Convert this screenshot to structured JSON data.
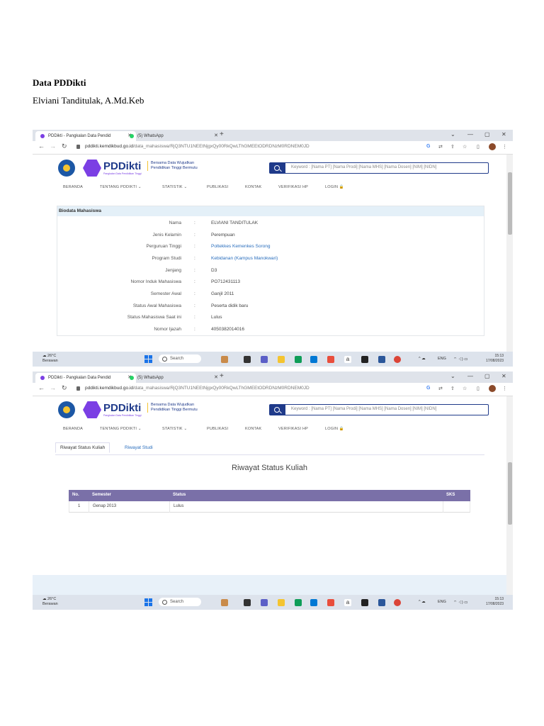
{
  "doc": {
    "title": "Data PDDikti",
    "name": "Elviani Tanditulak, A.Md.Keb"
  },
  "browser": {
    "tab_active": "PDDikti - Pangkalan Data Pendid",
    "tab_whatsapp": "(5) WhatsApp",
    "url_domain": "pddikti.kemdikbud.go.id",
    "url_path": "/data_mahasiswa/RjQ3NTU1NEEtNjgxQy00RkQwLThGMEEtODRDNzM0RDNEM0JD"
  },
  "site": {
    "logo_text": "PDDikti",
    "logo_sub": "Pangkalan Data Pendidikan Tinggi",
    "tagline_1": "Bersama Data Wujudkan",
    "tagline_2": "Pendidikan Tinggi Bermutu",
    "search_placeholder": "Keyword : [Nama PT] [Nama Prodi] [Nama MHS] [Nama Dosen] [NIM] [NIDN]",
    "menu": [
      "BERANDA",
      "TENTANG PDDIKTI",
      "STATISTIK",
      "PUBLIKASI",
      "KONTAK",
      "VERIFIKASI HP",
      "LOGIN"
    ]
  },
  "biodata": {
    "title": "Biodata Mahasiswa",
    "rows": [
      {
        "label": "Nama",
        "value": "ELVIANI TANDITULAK"
      },
      {
        "label": "Jenis Kelamin",
        "value": "Perempuan"
      },
      {
        "label": "Perguruan Tinggi",
        "value": "Poltekkes Kemenkes Sorong"
      },
      {
        "label": "Program Studi",
        "value": "Kebidanan (Kampus Manokwari)"
      },
      {
        "label": "Jenjang",
        "value": "D3"
      },
      {
        "label": "Nomor Induk Mahasiswa",
        "value": "PO712431113"
      },
      {
        "label": "Semester Awal",
        "value": "Ganjil 2011"
      },
      {
        "label": "Status Awal Mahasiswa",
        "value": "Peserta didik baru"
      },
      {
        "label": "Status Mahasiswa Saat ini",
        "value": "Lulus"
      },
      {
        "label": "Nomor Ijazah",
        "value": "4050382014016"
      }
    ]
  },
  "riwayat": {
    "tab_active": "Riwayat Status Kuliah",
    "tab_other": "Riwayat Studi",
    "heading": "Riwayat Status Kuliah",
    "columns": [
      "No.",
      "Semester",
      "Status",
      "SKS"
    ],
    "rows": [
      {
        "no": "1",
        "semester": "Genap 2013",
        "status": "Lulus",
        "sks": ""
      }
    ]
  },
  "taskbar": {
    "temp": "26°C",
    "location": "Berawan",
    "search": "Search",
    "lang": "ENG",
    "time": "15:13",
    "date": "17/08/2023"
  }
}
